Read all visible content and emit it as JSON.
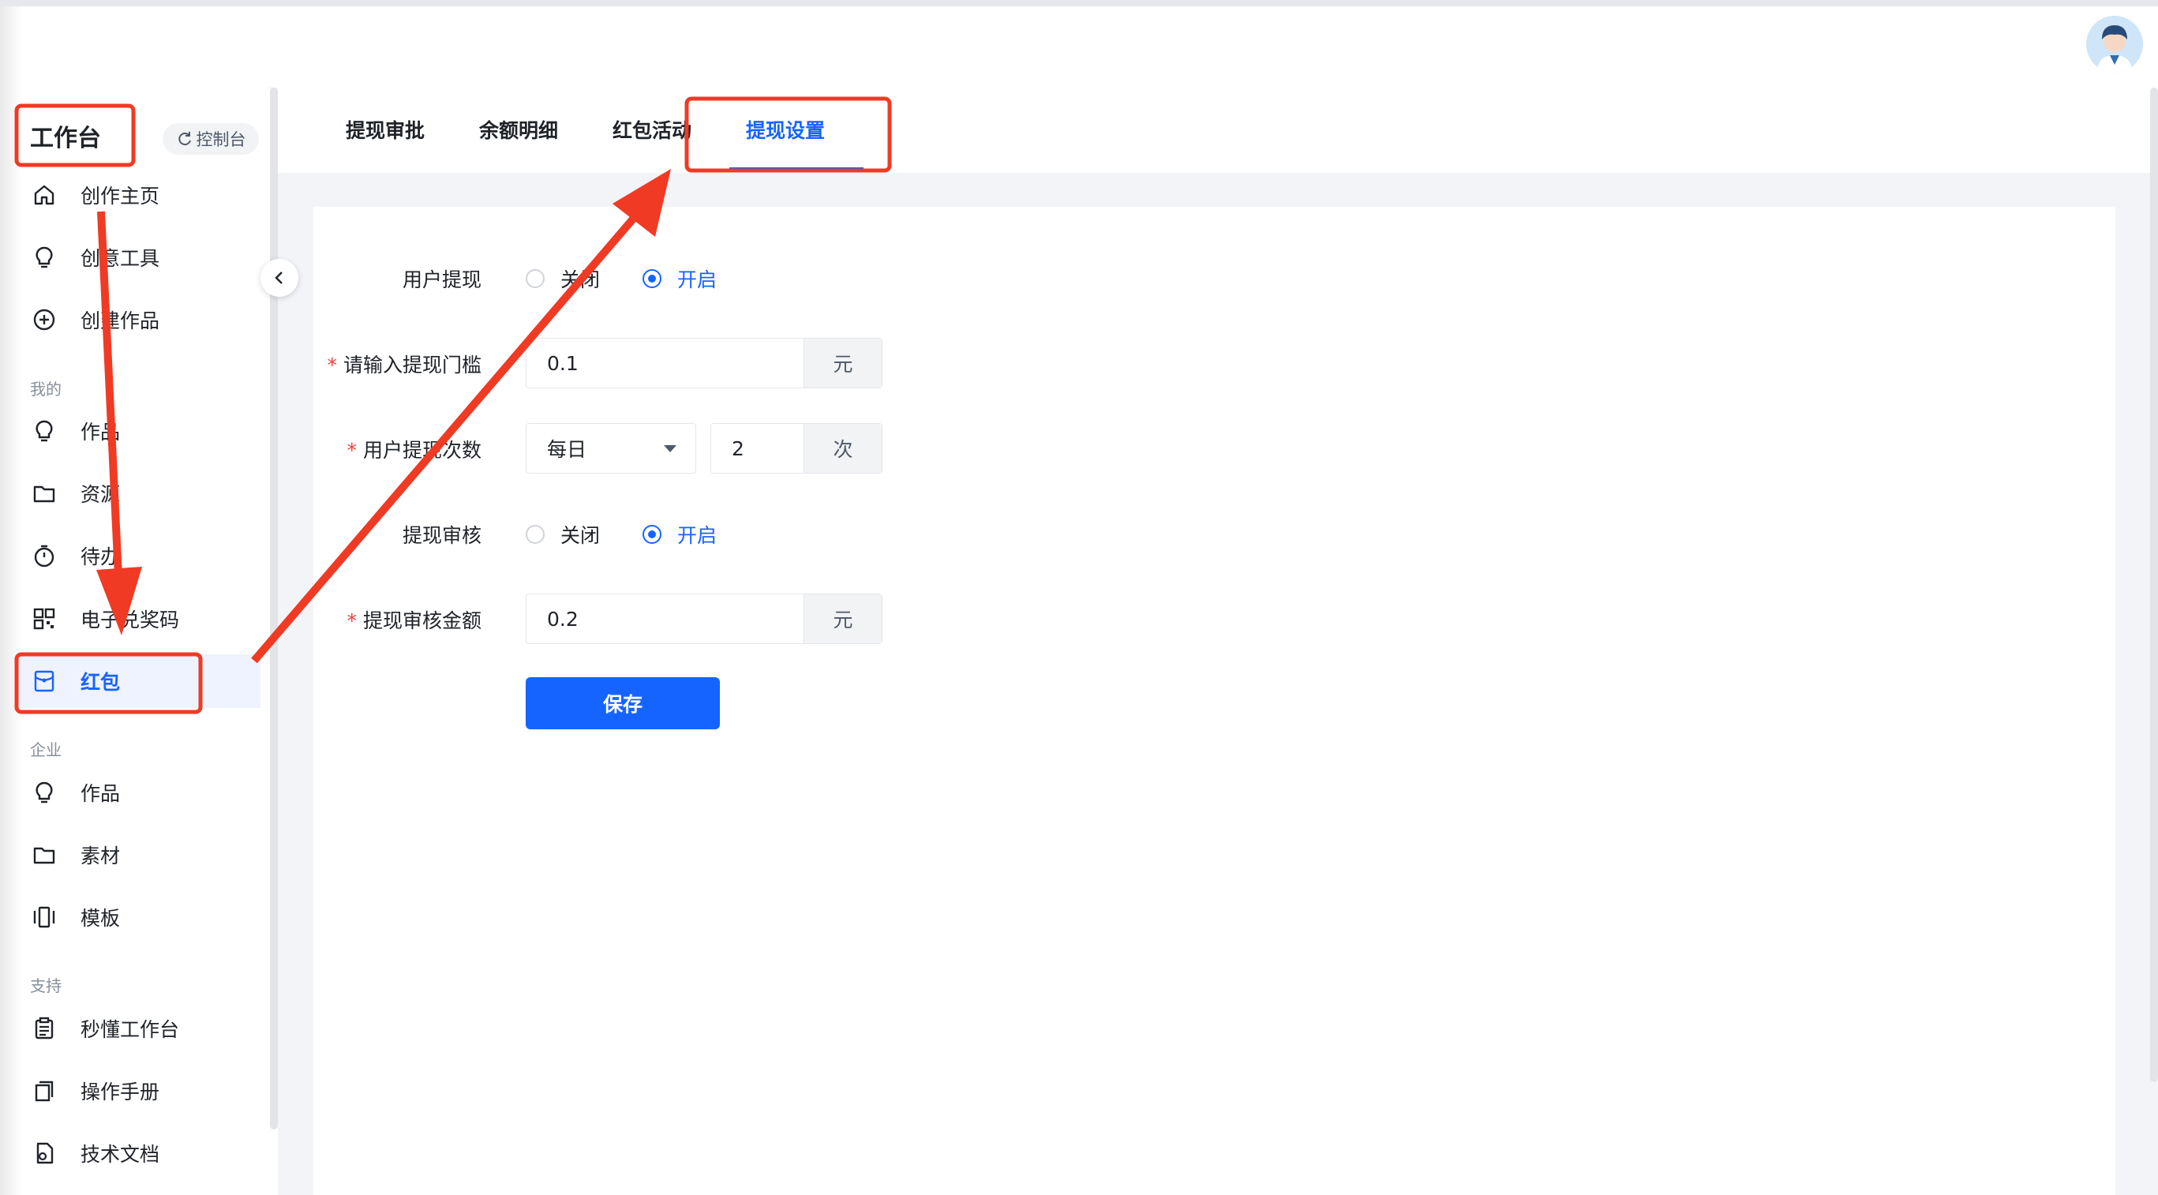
{
  "sidebar": {
    "title": "工作台",
    "console_label": "控制台",
    "items": [
      {
        "label": "创作主页",
        "icon": "home-icon"
      },
      {
        "label": "创意工具",
        "icon": "lightbulb-icon"
      },
      {
        "label": "创建作品",
        "icon": "plus-circle-icon"
      },
      {
        "label": "作品",
        "icon": "lightbulb-icon"
      },
      {
        "label": "资源",
        "icon": "folder-icon"
      },
      {
        "label": "待办",
        "icon": "timer-icon"
      },
      {
        "label": "电子兑奖码",
        "icon": "qrcode-icon"
      },
      {
        "label": "红包",
        "icon": "red-packet-icon"
      },
      {
        "label": "作品",
        "icon": "lightbulb-icon"
      },
      {
        "label": "素材",
        "icon": "folder-icon"
      },
      {
        "label": "模板",
        "icon": "template-icon"
      },
      {
        "label": "秒懂工作台",
        "icon": "clipboard-icon"
      },
      {
        "label": "操作手册",
        "icon": "copy-icon"
      },
      {
        "label": "技术文档",
        "icon": "document-icon"
      }
    ],
    "sections": [
      "我的",
      "企业",
      "支持"
    ],
    "active_item": "红包"
  },
  "tabs": [
    {
      "label": "提现审批"
    },
    {
      "label": "余额明细"
    },
    {
      "label": "红包活动"
    },
    {
      "label": "提现设置",
      "active": true
    }
  ],
  "form": {
    "user_withdraw": {
      "label": "用户提现",
      "options": [
        "关闭",
        "开启"
      ],
      "selected": "开启"
    },
    "threshold": {
      "label": "请输入提现门槛",
      "value": "0.1",
      "unit": "元",
      "required": true
    },
    "frequency": {
      "label": "用户提现次数",
      "period": "每日",
      "count": "2",
      "unit": "次",
      "required": true
    },
    "review": {
      "label": "提现审核",
      "options": [
        "关闭",
        "开启"
      ],
      "selected": "开启"
    },
    "review_amount": {
      "label": "提现审核金额",
      "value": "0.2",
      "unit": "元",
      "required": true
    },
    "save_label": "保存"
  },
  "colors": {
    "accent": "#1664ff",
    "annotation": "#f03a24",
    "active_bg": "#eef3ff",
    "content_bg": "#f2f4f7"
  }
}
